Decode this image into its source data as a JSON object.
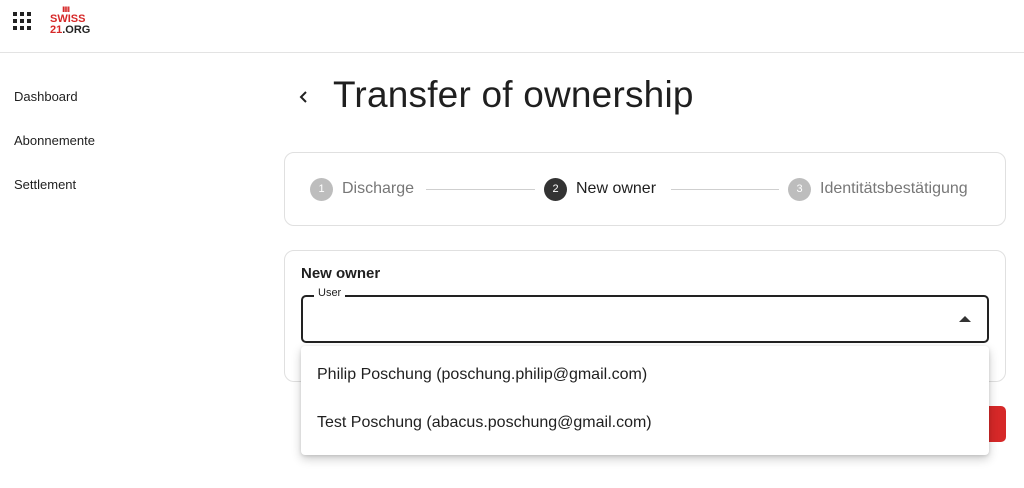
{
  "header": {
    "apps_icon": "grid-icon",
    "logo": {
      "mark": "ıııı",
      "line1": "SWISS",
      "line2_a": "21",
      "line2_b": ".ORG"
    }
  },
  "sidebar": {
    "items": [
      {
        "label": "Dashboard"
      },
      {
        "label": "Abonnemente"
      },
      {
        "label": "Settlement"
      }
    ]
  },
  "page": {
    "back_icon": "chevron-left-icon",
    "title": "Transfer of ownership"
  },
  "stepper": {
    "steps": [
      {
        "number": "1",
        "label": "Discharge",
        "state": "inactive"
      },
      {
        "number": "2",
        "label": "New owner",
        "state": "active"
      },
      {
        "number": "3",
        "label": "Identitätsbestätigung",
        "state": "inactive"
      }
    ]
  },
  "form": {
    "section_title": "New owner",
    "user_field": {
      "label": "User",
      "value": ""
    }
  },
  "dropdown": {
    "options": [
      {
        "label": "Philip Poschung (poschung.philip@gmail.com)"
      },
      {
        "label": "Test Poschung (abacus.poschung@gmail.com)"
      }
    ]
  },
  "colors": {
    "accent": "#d62828",
    "active_step": "#333333",
    "inactive_step": "#bdbdbd"
  }
}
